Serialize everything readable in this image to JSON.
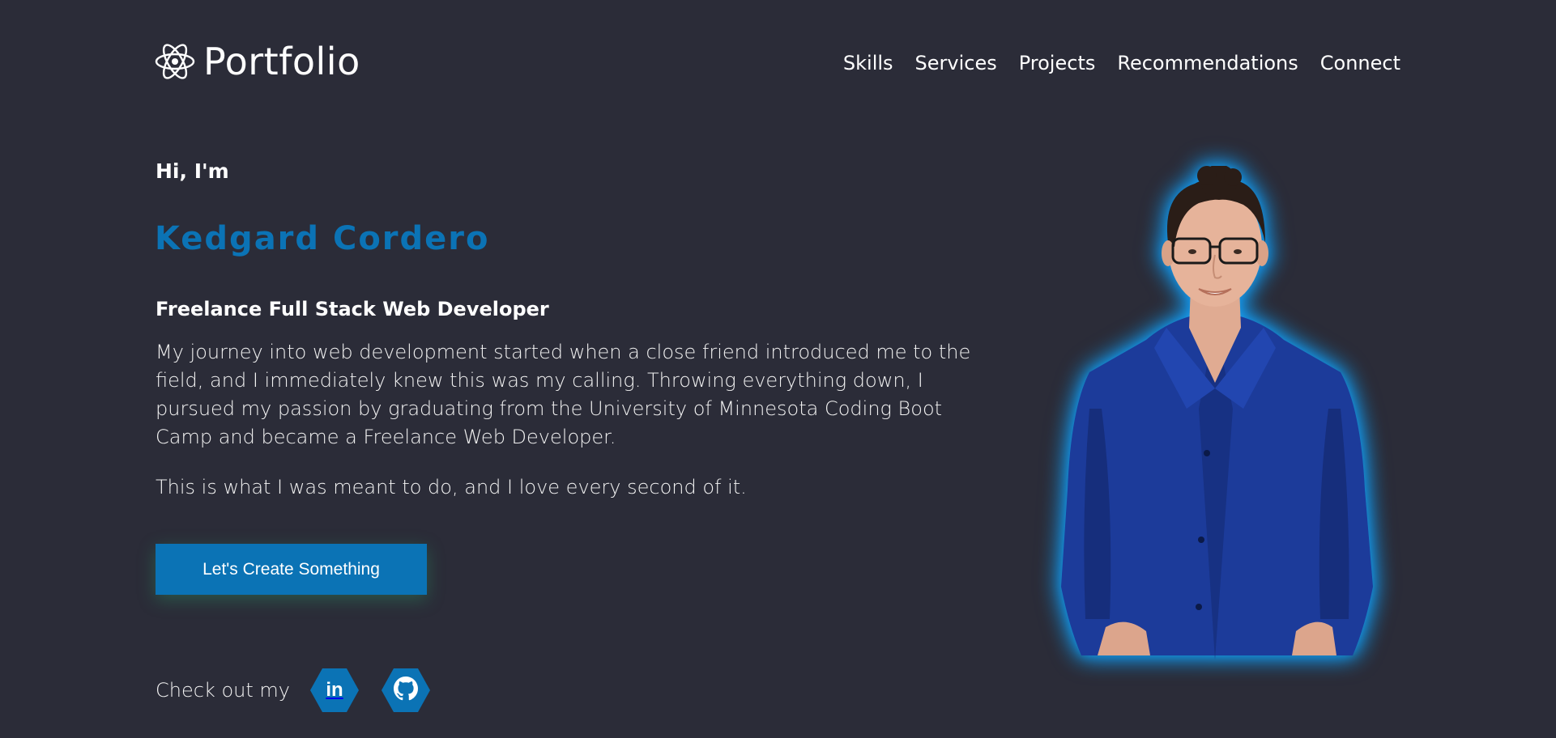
{
  "header": {
    "logo_text": "Portfolio",
    "logo_icon": "react-atom-icon"
  },
  "nav": {
    "items": [
      "Skills",
      "Services",
      "Projects",
      "Recommendations",
      "Connect"
    ]
  },
  "hero": {
    "greeting": "Hi, I'm",
    "name": "Kedgard Cordero",
    "role": "Freelance Full Stack Web Developer",
    "bio": "My journey into web development started when a close friend introduced me to the field, and I immediately knew this was my calling. Throwing everything down, I pursued my passion by graduating from the University of Minnesota Coding Boot Camp and became a Freelance Web Developer.",
    "bio2": "This is what I was meant to do, and I love every second of it.",
    "cta_label": "Let's Create Something"
  },
  "social": {
    "label": "Check out my",
    "links": [
      {
        "icon": "linkedin-icon",
        "text": "in"
      },
      {
        "icon": "github-icon"
      }
    ]
  },
  "colors": {
    "background": "#2b2c38",
    "accent": "#0b73b5",
    "glow": "#1aa6ff",
    "shirt": "#1c3b9a"
  }
}
